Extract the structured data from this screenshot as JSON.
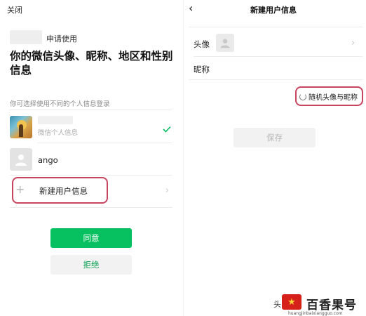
{
  "left": {
    "close_label": "关闭",
    "request_text": "申请使用",
    "title": "你的微信头像、昵称、地区和性别信息",
    "hint": "你可选择使用不同的个人信息登录",
    "accounts": [
      {
        "subtitle": "微信个人信息",
        "selected": true
      },
      {
        "name": "ango"
      }
    ],
    "new_info_label": "新建用户信息",
    "agree_label": "同意",
    "reject_label": "拒绝"
  },
  "right": {
    "title": "新建用户信息",
    "avatar_label": "头像",
    "nickname_label": "昵称",
    "random_label": "随机头像与昵称",
    "save_label": "保存"
  },
  "watermark": {
    "prefix": "头",
    "badge": "★",
    "text": "百香果号",
    "url": "huangjinbaixiangguo.com"
  },
  "colors": {
    "accent_green": "#07c160",
    "highlight_red": "#c8455f"
  },
  "icons": {
    "close": "close-text",
    "back": "chevron-left-icon",
    "check": "check-icon",
    "plus": "plus-icon",
    "chevron": "chevron-right-icon",
    "default_avatar": "person-icon",
    "random": "refresh-icon"
  }
}
